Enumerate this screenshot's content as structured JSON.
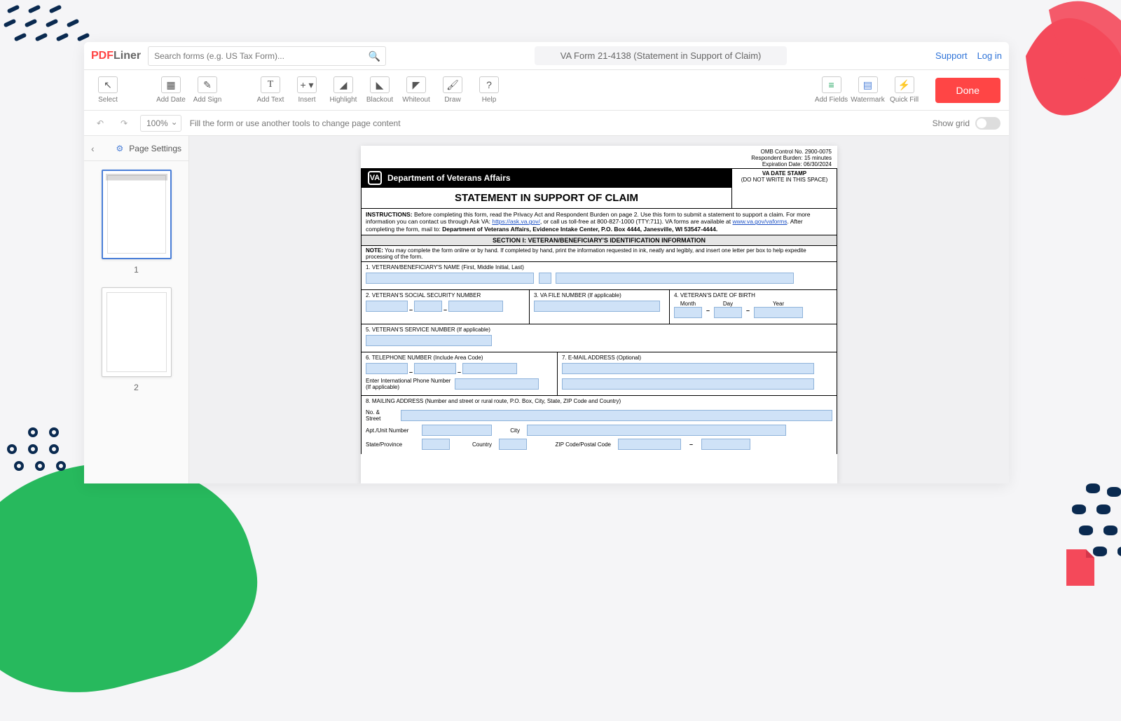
{
  "header": {
    "logo_pd": "PDF",
    "logo_liner": "Liner",
    "search_placeholder": "Search forms (e.g. US Tax Form)...",
    "doc_title": "VA Form 21-4138 (Statement in Support of Claim)",
    "support": "Support",
    "login": "Log in"
  },
  "toolbar": {
    "select": "Select",
    "add_date": "Add Date",
    "add_sign": "Add Sign",
    "add_text": "Add Text",
    "insert": "Insert",
    "highlight": "Highlight",
    "blackout": "Blackout",
    "whiteout": "Whiteout",
    "draw": "Draw",
    "help": "Help",
    "add_fields": "Add Fields",
    "watermark": "Watermark",
    "quick_fill": "Quick Fill",
    "done": "Done"
  },
  "subbar": {
    "zoom": "100%",
    "hint": "Fill the form or use another tools to change page content",
    "show_grid": "Show grid"
  },
  "sidebar": {
    "page_settings": "Page Settings",
    "p1": "1",
    "p2": "2"
  },
  "form": {
    "omb1": "OMB Control No. 2900-0075",
    "omb2": "Respondent Burden: 15 minutes",
    "omb3": "Expiration Date: 06/30/2024",
    "dept": "Department of Veterans Affairs",
    "stamp1": "VA DATE STAMP",
    "stamp2": "(DO NOT WRITE IN THIS SPACE)",
    "title": "STATEMENT IN SUPPORT OF CLAIM",
    "instr_label": "INSTRUCTIONS:",
    "instr_text1": " Before completing this form, read the Privacy Act and Respondent Burden on page 2. Use this form to submit a statement to support a claim. For more information you can contact us through Ask VA: ",
    "instr_link1": "https://ask.va.gov/",
    "instr_text2": ", or call us toll-free at 800-827-1000 (TTY:711). VA forms are available at ",
    "instr_link2": "www.va.gov/vaforms",
    "instr_text3": ". After completing the form, mail to: ",
    "instr_bold": "Department of Veterans Affairs, Evidence Intake Center, P.O. Box 4444, Janesville, WI 53547-4444.",
    "section1": "SECTION I:  VETERAN/BENEFICIARY'S IDENTIFICATION INFORMATION",
    "note_label": "NOTE:",
    "note_text": " You may complete the form online or by hand. If completed by hand, print the information requested in ink, neatly and legibly, and insert one letter per box to help expedite processing of the form.",
    "f1": "1. VETERAN/BENEFICIARY'S NAME (First, Middle Initial, Last)",
    "f2": "2. VETERAN'S SOCIAL SECURITY NUMBER",
    "f3": "3. VA FILE NUMBER (If applicable)",
    "f4": "4. VETERAN'S DATE OF BIRTH",
    "f4m": "Month",
    "f4d": "Day",
    "f4y": "Year",
    "f5": "5. VETERAN'S SERVICE NUMBER (If applicable)",
    "f6": "6. TELEPHONE NUMBER (Include Area Code)",
    "f6b": "Enter International Phone Number",
    "f6c": "(If applicable)",
    "f7": "7. E-MAIL ADDRESS (Optional)",
    "f8": "8. MAILING ADDRESS (Number and street or rural route, P.O. Box, City, State, ZIP Code and Country)",
    "f8a": "No. & Street",
    "f8b": "Apt./Unit Number",
    "f8c": "City",
    "f8d": "State/Province",
    "f8e": "Country",
    "f8f": "ZIP Code/Postal Code"
  }
}
